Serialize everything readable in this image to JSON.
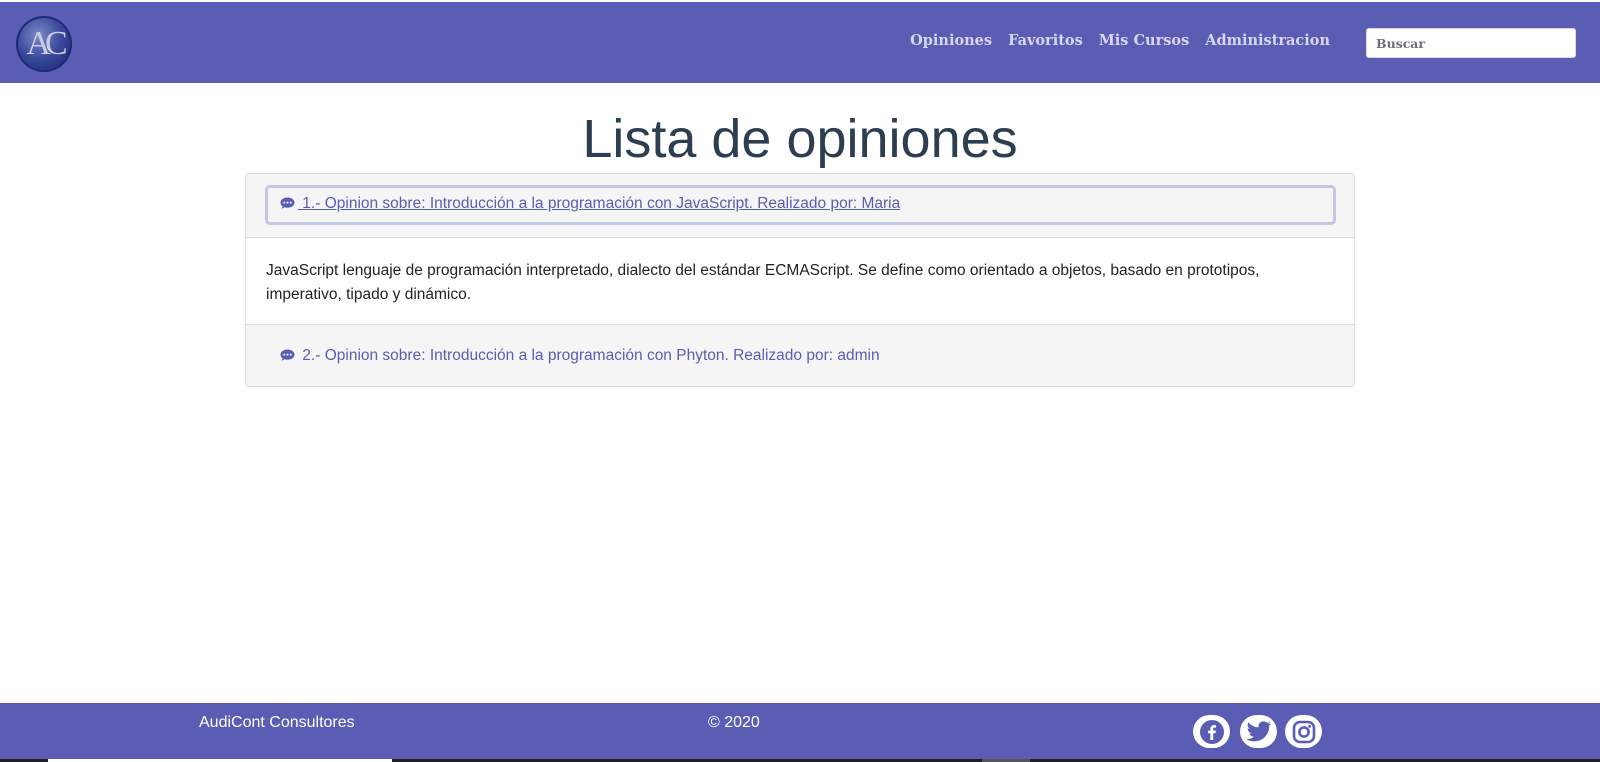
{
  "navbar": {
    "logo_text": "AC",
    "links": [
      "Opiniones",
      "Favoritos",
      "Mis Cursos",
      "Administracion"
    ],
    "search_placeholder": "Buscar"
  },
  "main": {
    "title": "Lista de opiniones",
    "opinions": [
      {
        "icon": "comment-dots-icon",
        "link": " 1.- Opinion sobre: Introducción a la programación con JavaScript. Realizado por: Maria",
        "expanded": true,
        "body": "JavaScript lenguaje de programación interpretado, dialecto del estándar ECMAScript. Se define como orientado a objetos,  basado en prototipos, imperativo, tipado y dinámico."
      },
      {
        "icon": "comment-dots-icon",
        "link": " 2.- Opinion sobre: Introducción a la programación con Phyton. Realizado por: admin",
        "expanded": false
      }
    ]
  },
  "footer": {
    "brand": "AudiCont Consultores",
    "copyright": "© 2020",
    "social": [
      "facebook-icon",
      "twitter-icon",
      "instagram-icon"
    ]
  },
  "colors": {
    "brand": "#5b5db5",
    "title": "#2c3e50",
    "panel_header": "#f5f5f5"
  }
}
